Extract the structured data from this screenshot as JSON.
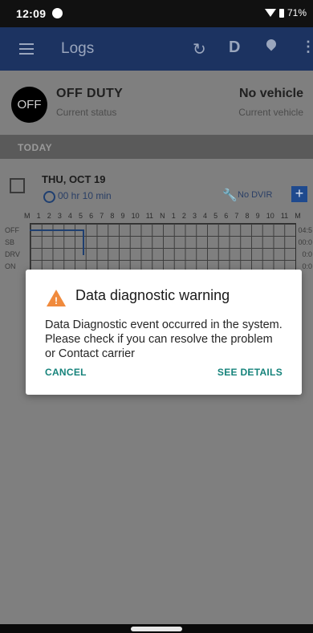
{
  "status_bar": {
    "time": "12:09",
    "battery": "71%"
  },
  "app_bar": {
    "title": "Logs",
    "duty_button": "D"
  },
  "current_status": {
    "badge": "OFF",
    "status": "OFF DUTY",
    "status_caption": "Current status",
    "vehicle": "No vehicle",
    "vehicle_caption": "Current vehicle"
  },
  "section_header": "TODAY",
  "day_log": {
    "date": "THU, OCT 19",
    "hours": "00 hr 10 min",
    "dvir": "No DVIR",
    "add_label": "+",
    "hour_labels": [
      "M",
      "1",
      "2",
      "3",
      "4",
      "5",
      "6",
      "7",
      "8",
      "9",
      "10",
      "11",
      "N",
      "1",
      "2",
      "3",
      "4",
      "5",
      "6",
      "7",
      "8",
      "9",
      "10",
      "11",
      "M"
    ],
    "rows": [
      {
        "label": "OFF",
        "total": "04:5"
      },
      {
        "label": "SB",
        "total": "00:0"
      },
      {
        "label": "DRV",
        "total": "0:0"
      },
      {
        "label": "ON",
        "total": "0:0"
      }
    ]
  },
  "dialog": {
    "title": "Data diagnostic warning",
    "message": "Data Diagnostic event occurred in the system. Please check if you can resolve the problem or Contact carrier",
    "cancel": "CANCEL",
    "details": "SEE DETAILS"
  },
  "colors": {
    "app_bar": "#1c3361",
    "accent": "#16837b",
    "warning": "#f08a3c"
  }
}
